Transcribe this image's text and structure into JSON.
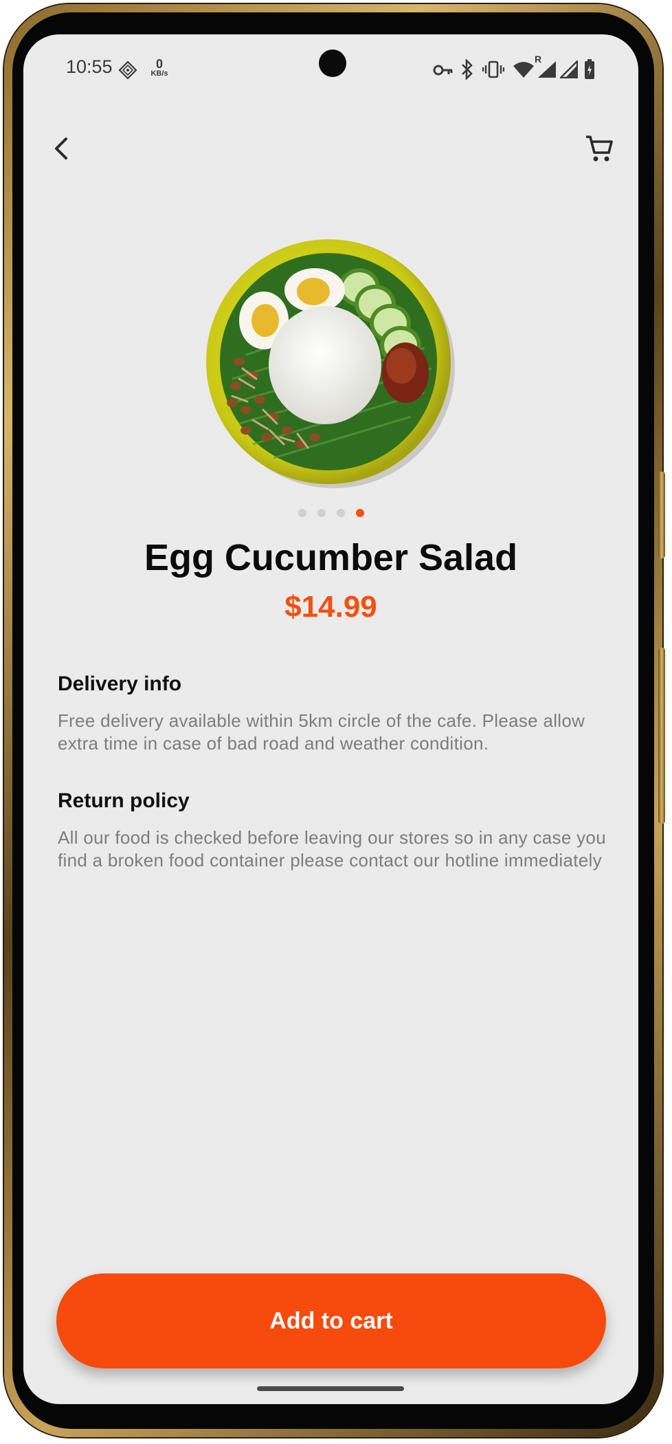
{
  "status_bar": {
    "time": "10:55",
    "net_speed_value": "0",
    "net_speed_unit": "KB/s",
    "signal_roaming": "R"
  },
  "nav": {
    "back_icon": "chevron-left-icon",
    "cart_icon": "shopping-cart-icon"
  },
  "product": {
    "image_icon": "food-plate-image",
    "carousel_total": 4,
    "carousel_active_index": 3,
    "name": "Egg Cucumber Salad",
    "price": "$14.99"
  },
  "delivery": {
    "heading": "Delivery info",
    "text": "Free delivery available within 5km circle of the cafe. Please allow extra time in case of bad road and weather condition."
  },
  "returns": {
    "heading": "Return policy",
    "text": "All our food is checked before leaving our stores so in any case you find a broken food container please contact our hotline immediately"
  },
  "actions": {
    "add_to_cart_label": "Add to cart"
  },
  "colors": {
    "accent": "#f4500f",
    "background": "#ebebeb",
    "heading_text": "#101010",
    "body_text": "#7d7d7d"
  }
}
